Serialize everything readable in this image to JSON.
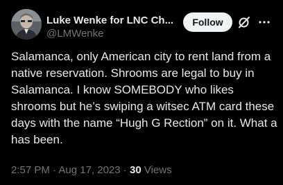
{
  "author": {
    "display_name": "Luke Wenke for LNC Ch...",
    "handle": "@LMWenke",
    "avatar_icon": "user-avatar"
  },
  "header": {
    "follow_label": "Follow",
    "grok_icon": "grok-icon",
    "more_icon": "more-dots-icon"
  },
  "tweet": {
    "text": "Salamanca, only American city to rent land from a native reservation.  Shrooms are legal to buy in Salamanca.  I know SOMEBODY who likes shrooms but he’s swiping a witsec ATM card these days with the name “Hugh G Rection” on it.  What a has been."
  },
  "meta": {
    "time": "2:57 PM",
    "separator": " · ",
    "date": "Aug 17, 2023",
    "views_count": "30",
    "views_label": "Views"
  },
  "colors": {
    "background": "#000000",
    "text": "#e7e9ea",
    "secondary": "#71767b",
    "follow_bg": "#eff3f4"
  }
}
